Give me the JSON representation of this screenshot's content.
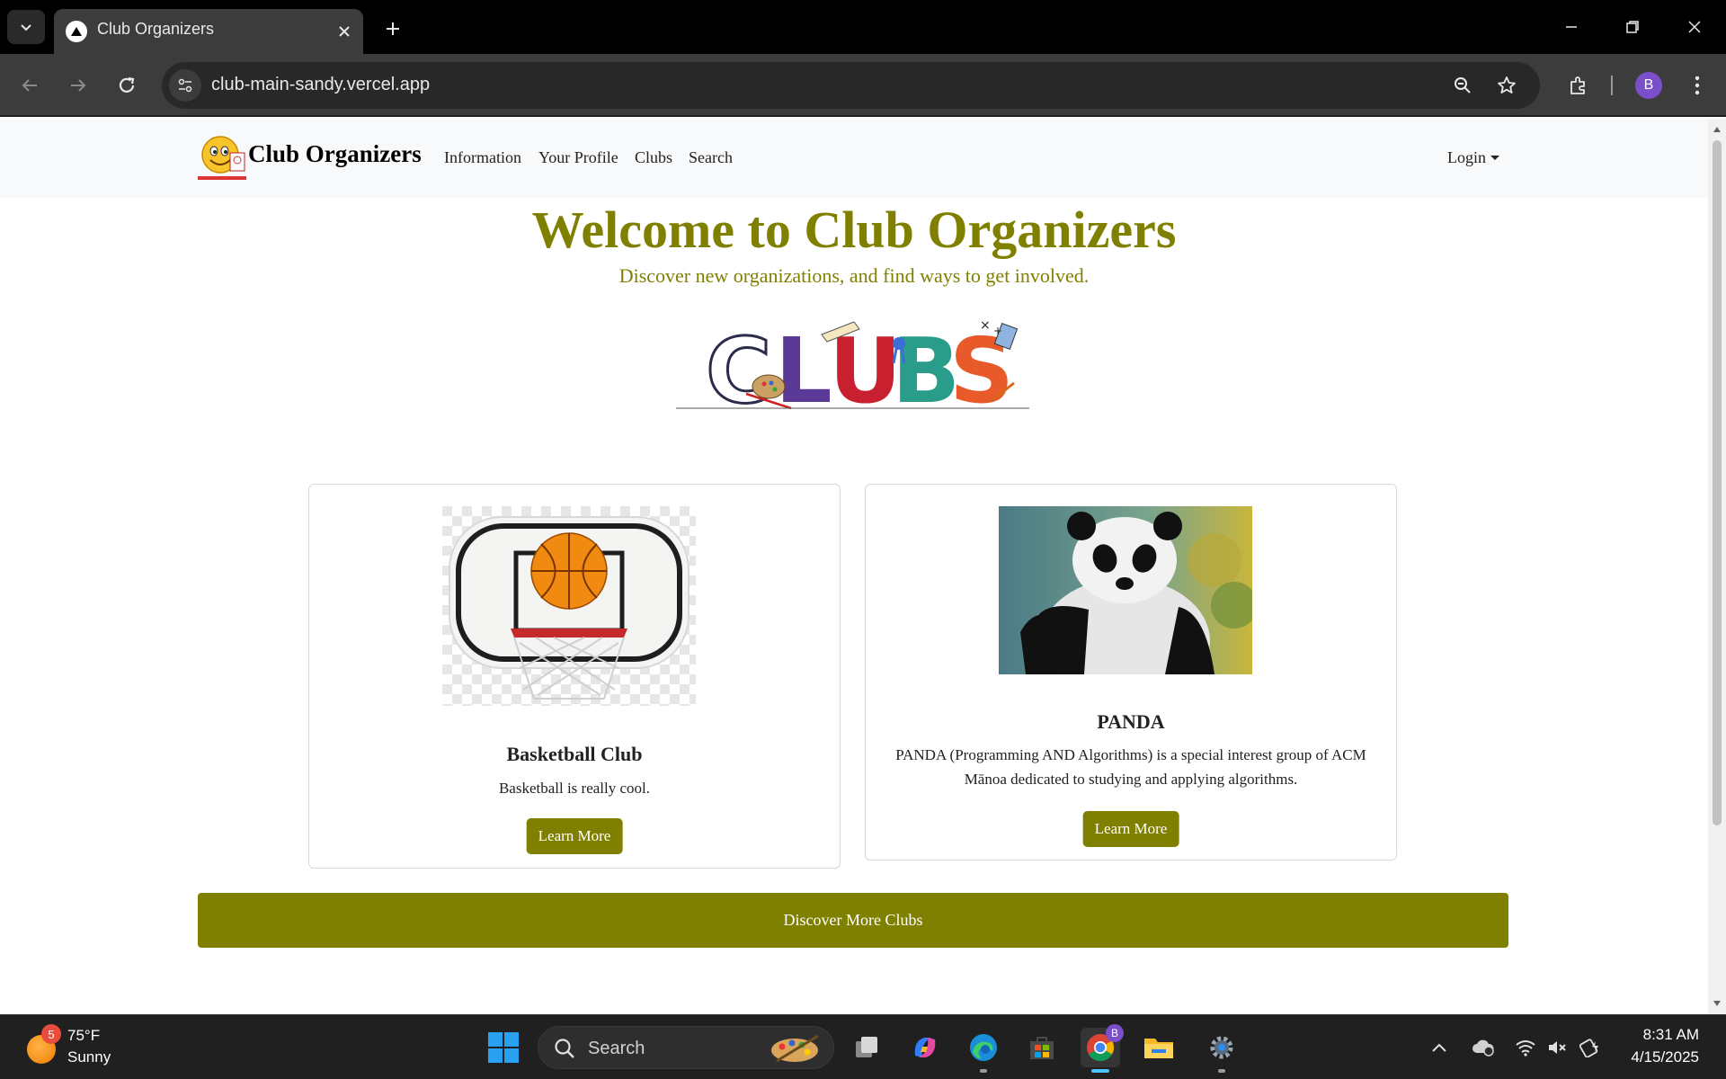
{
  "browser": {
    "tab": {
      "title": "Club Organizers",
      "favicon": "vercel-triangle-icon"
    },
    "url": "club-main-sandy.vercel.app",
    "profile_initial": "B",
    "icons": [
      "tab-list-chevron-icon",
      "close-icon",
      "plus-icon",
      "minimize-icon",
      "restore-icon",
      "back-arrow-icon",
      "forward-arrow-icon",
      "reload-icon",
      "site-settings-icon",
      "zoom-icon",
      "star-icon",
      "extensions-icon",
      "more-vert-icon"
    ]
  },
  "site": {
    "brand": "Club Organizers",
    "nav": [
      "Information",
      "Your Profile",
      "Clubs",
      "Search"
    ],
    "login": "Login",
    "hero": {
      "title": "Welcome to Club Organizers",
      "subtitle": "Discover new organizations, and find ways to get involved."
    },
    "cards": [
      {
        "title": "Basketball Club",
        "text": "Basketball is really cool.",
        "button": "Learn More",
        "image": "basketball-hoop"
      },
      {
        "title": "PANDA",
        "text": "PANDA (Programming AND Algorithms) is a special interest group of ACM Mānoa dedicated to studying and applying algorithms.",
        "button": "Learn More",
        "image": "panda-photo"
      }
    ],
    "discover_button": "Discover More Clubs",
    "colors": {
      "accent": "#808000",
      "nav_bg": "#f8f9fa"
    }
  },
  "taskbar": {
    "weather": {
      "badge": "5",
      "temp": "75°F",
      "condition": "Sunny"
    },
    "search_label": "Search",
    "profile_badge": "B",
    "clock": {
      "time": "8:31 AM",
      "date": "4/15/2025"
    }
  }
}
